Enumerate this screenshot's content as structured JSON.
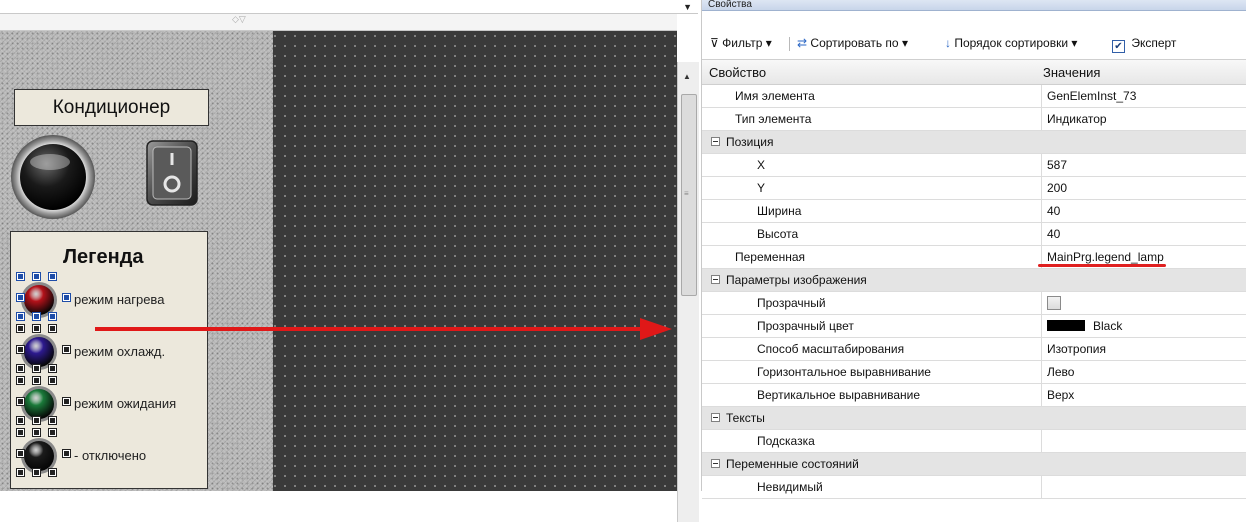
{
  "editor": {
    "title_label": "Кондиционер",
    "legend": {
      "title": "Легенда",
      "items": [
        {
          "label": "режим нагрева",
          "color": "#b3121a"
        },
        {
          "label": "режим охлажд.",
          "color": "#2d1a8f"
        },
        {
          "label": "режим ожидания",
          "color": "#1a7a3a"
        },
        {
          "label": "- отключено",
          "color": "#1b1b1b"
        }
      ]
    },
    "arrow_color": "#e01818"
  },
  "properties": {
    "panel_title": "Свойства",
    "toolbar": {
      "filter_label": "Фильтр",
      "sort_by_label": "Сортировать по",
      "sort_order_label": "Порядок сортировки",
      "expert_label": "Эксперт",
      "expert_checked": true
    },
    "columns": {
      "property": "Свойство",
      "value": "Значения"
    },
    "rows": [
      {
        "name": "Имя элемента",
        "value": "GenElemInst_73",
        "level": 1
      },
      {
        "name": "Тип элемента",
        "value": "Индикатор",
        "level": 1
      },
      {
        "name": "Позиция",
        "group": true
      },
      {
        "name": "X",
        "value": "587",
        "level": 2
      },
      {
        "name": "Y",
        "value": "200",
        "level": 2
      },
      {
        "name": "Ширина",
        "value": "40",
        "level": 2
      },
      {
        "name": "Высота",
        "value": "40",
        "level": 2
      },
      {
        "name": "Переменная",
        "value": "MainPrg.legend_lamp",
        "level": 1,
        "highlighted": true
      },
      {
        "name": "Параметры изображения",
        "group": true
      },
      {
        "name": "Прозрачный",
        "level": 2,
        "checkbox": true,
        "checked": false
      },
      {
        "name": "Прозрачный цвет",
        "value": "Black",
        "level": 2,
        "swatch": "#000000"
      },
      {
        "name": "Способ масштабирования",
        "value": "Изотропия",
        "level": 2
      },
      {
        "name": "Горизонтальное выравнивание",
        "value": "Лево",
        "level": 2
      },
      {
        "name": "Вертикальное выравнивание",
        "value": "Верх",
        "level": 2
      },
      {
        "name": "Тексты",
        "group": true
      },
      {
        "name": "Подсказка",
        "value": "",
        "level": 2
      },
      {
        "name": "Переменные состояний",
        "group": true
      },
      {
        "name": "Невидимый",
        "value": "",
        "level": 2
      }
    ]
  }
}
